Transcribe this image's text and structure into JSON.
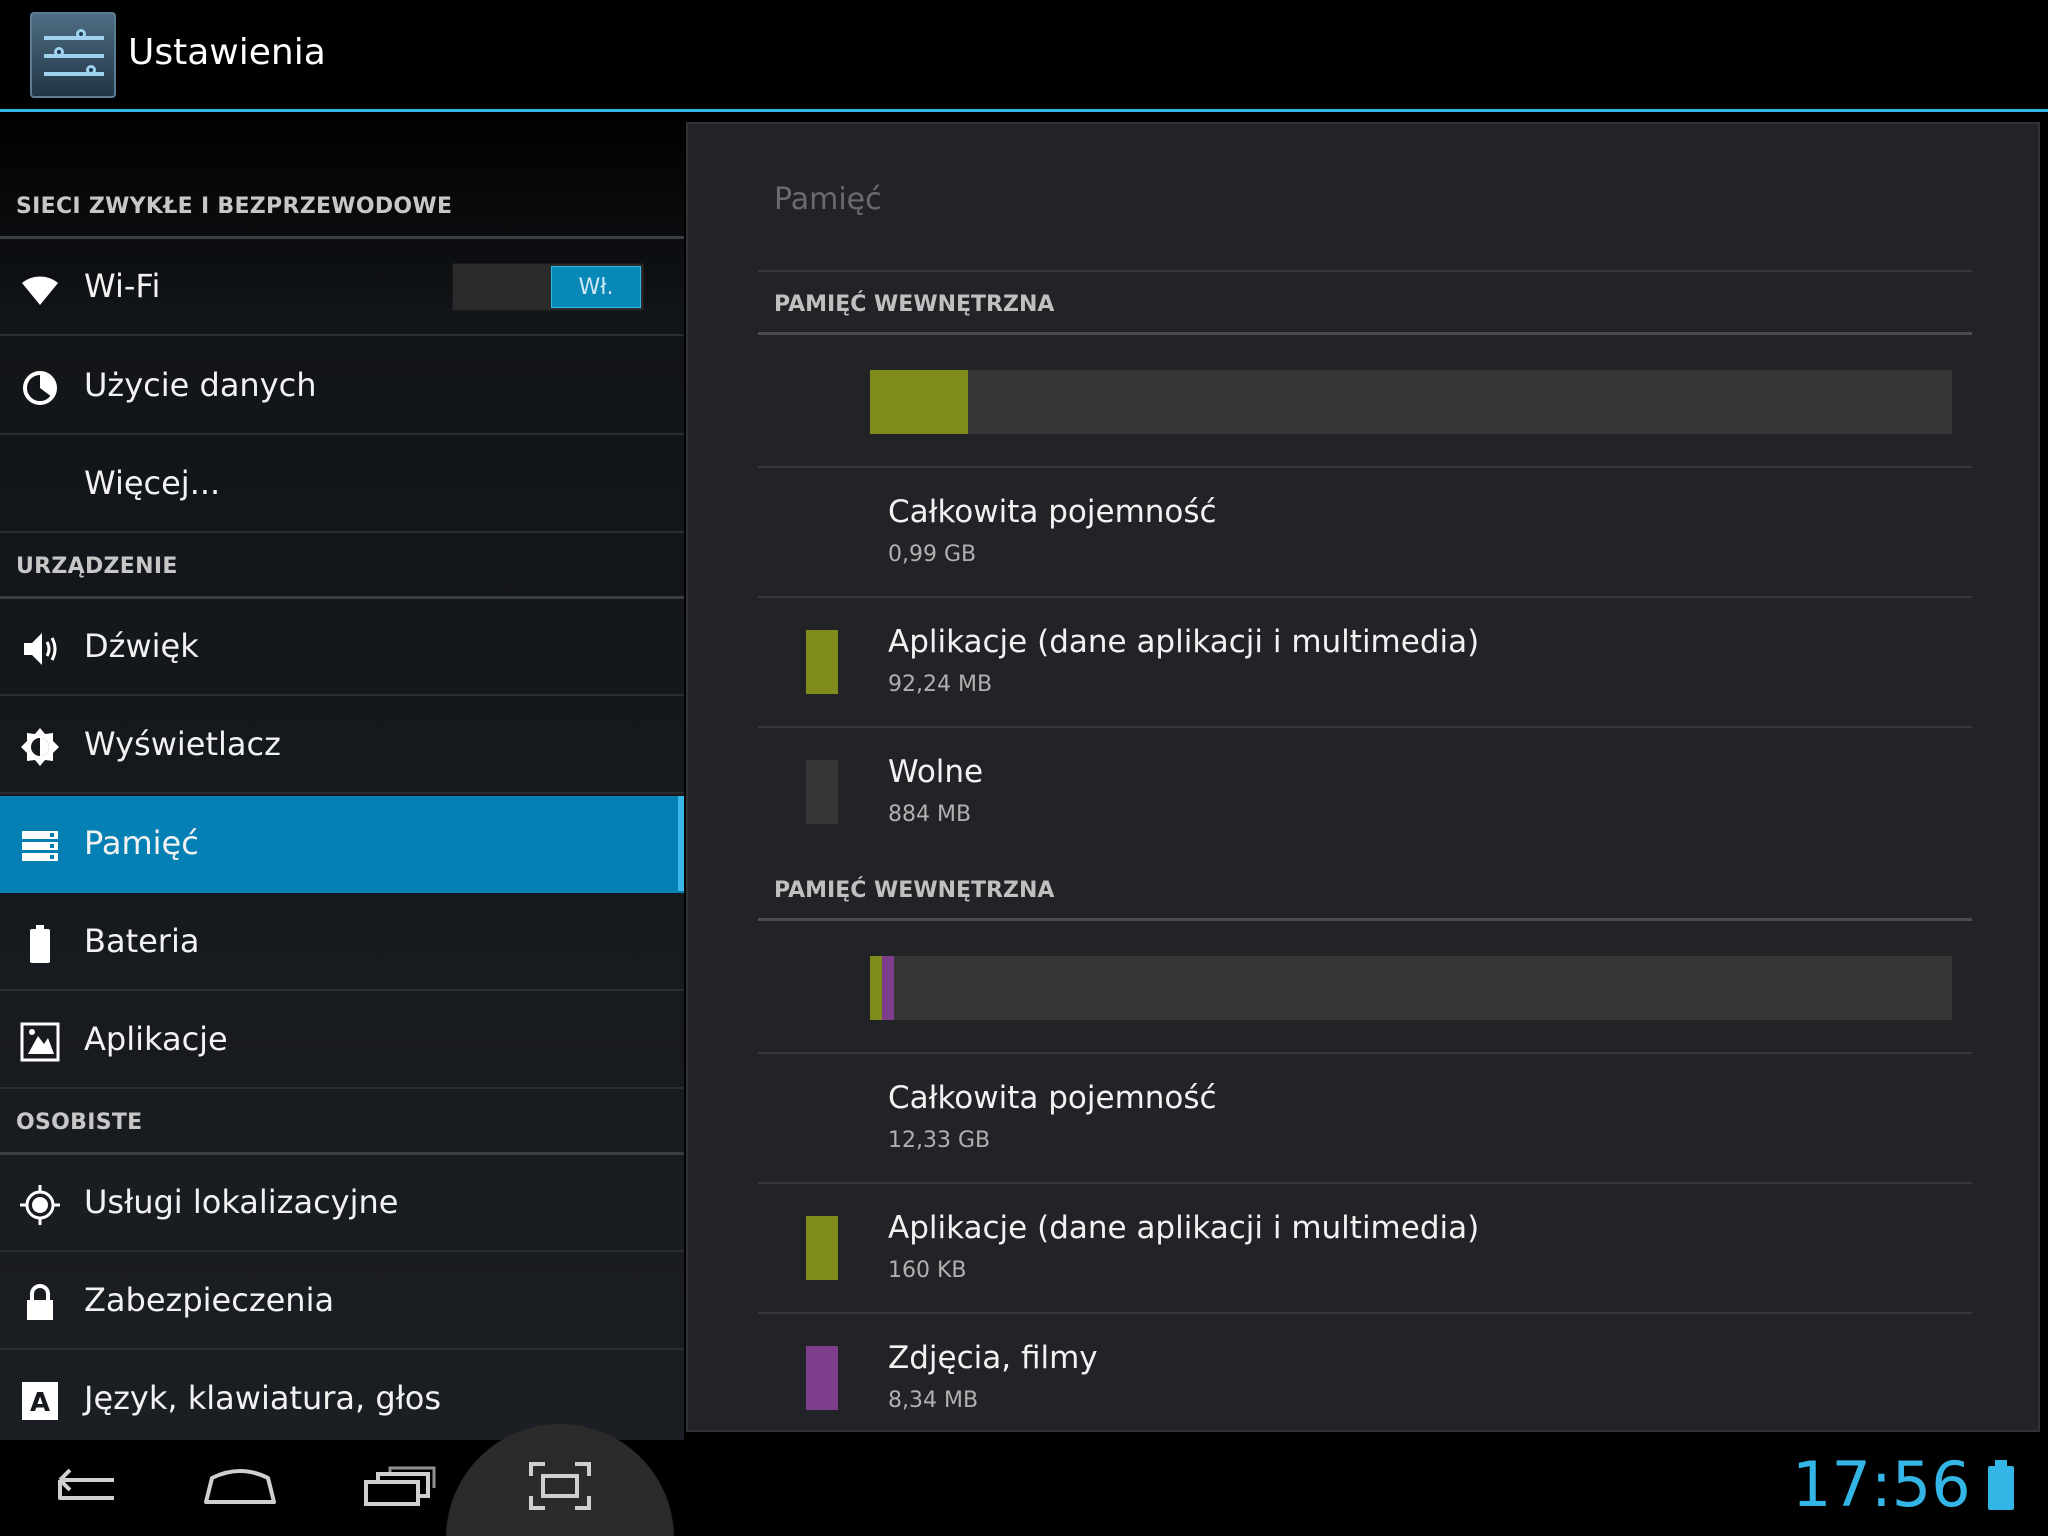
{
  "app": {
    "title": "Ustawienia"
  },
  "sidebar": {
    "sections": [
      {
        "header": "SIECI ZWYKŁE I BEZPRZEWODOWE"
      },
      {
        "header": "URZĄDZENIE"
      },
      {
        "header": "OSOBISTE"
      }
    ],
    "items": [
      {
        "label": "Wi-Fi",
        "icon": "wifi-icon",
        "toggle": "Wł."
      },
      {
        "label": "Użycie danych",
        "icon": "data-usage-icon"
      },
      {
        "label": "Więcej..."
      },
      {
        "label": "Dźwięk",
        "icon": "speaker-icon"
      },
      {
        "label": "Wyświetlacz",
        "icon": "brightness-icon"
      },
      {
        "label": "Pamięć",
        "icon": "storage-icon",
        "selected": true
      },
      {
        "label": "Bateria",
        "icon": "battery-icon"
      },
      {
        "label": "Aplikacje",
        "icon": "apps-icon"
      },
      {
        "label": "Usługi lokalizacyjne",
        "icon": "location-icon"
      },
      {
        "label": "Zabezpieczenia",
        "icon": "lock-icon"
      },
      {
        "label": "Język, klawiatura, głos",
        "icon": "language-icon"
      }
    ]
  },
  "main": {
    "title": "Pamięć",
    "storages": [
      {
        "header": "PAMIĘĆ WEWNĘTRZNA",
        "usage_fractions": {
          "apps": 0.091,
          "media": 0
        },
        "rows": [
          {
            "title": "Całkowita pojemność",
            "value": "0,99 GB"
          },
          {
            "title": "Aplikacje (dane aplikacji i multimedia)",
            "value": "92,24 MB",
            "color": "#7f8c1b"
          },
          {
            "title": "Wolne",
            "value": "884 MB",
            "color": "#353535"
          }
        ]
      },
      {
        "header": "PAMIĘĆ WEWNĘTRZNA",
        "usage_fractions": {
          "apps": 0.011,
          "media": 0.011
        },
        "rows": [
          {
            "title": "Całkowita pojemność",
            "value": "12,33 GB"
          },
          {
            "title": "Aplikacje (dane aplikacji i multimedia)",
            "value": "160 KB",
            "color": "#7f8c1b"
          },
          {
            "title": "Zdjęcia, filmy",
            "value": "8,34 MB",
            "color": "#7b3d8c"
          }
        ]
      }
    ],
    "colors": {
      "apps": "#7f8c1b",
      "media": "#7b3d8c",
      "free": "#353535"
    }
  },
  "statusbar": {
    "time": "17:56"
  },
  "navbar": {
    "buttons": [
      "back-icon",
      "home-icon",
      "recent-apps-icon",
      "screenshot-icon"
    ]
  },
  "theme": {
    "accent": "#33b5e5",
    "selected": "#0480b4"
  }
}
